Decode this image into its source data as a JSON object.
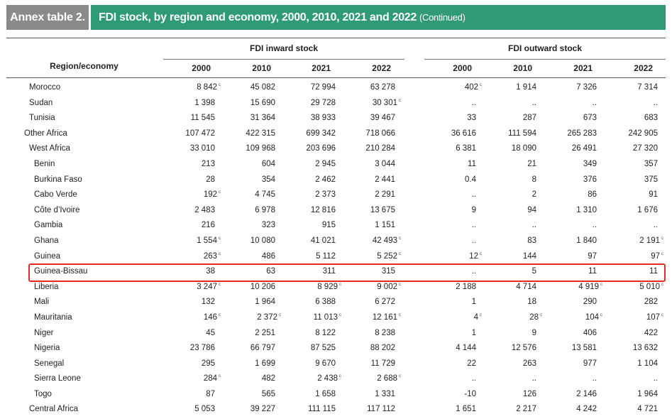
{
  "title": {
    "label": "Annex table 2.",
    "text": "FDI stock, by region and economy, 2000, 2010, 2021 and 2022",
    "continued": "(Continued)"
  },
  "header": {
    "region_label": "Region/economy",
    "inward_label": "FDI inward stock",
    "outward_label": "FDI outward stock",
    "years": [
      "2000",
      "2010",
      "2021",
      "2022"
    ]
  },
  "highlight_color": "#e52b20",
  "rows": [
    {
      "name": "Morocco",
      "indent": 1,
      "in": [
        "8 842",
        "45 082",
        "72 994",
        "63 278"
      ],
      "in_sup": [
        "c",
        "",
        "",
        ""
      ],
      "out": [
        "402",
        "1 914",
        "7 326",
        "7 314"
      ],
      "out_sup": [
        "c",
        "",
        "",
        ""
      ]
    },
    {
      "name": "Sudan",
      "indent": 1,
      "in": [
        "1 398",
        "15 690",
        "29 728",
        "30 301"
      ],
      "in_sup": [
        "",
        "",
        "",
        "c"
      ],
      "out": [
        "..",
        "..",
        "..",
        ".."
      ],
      "out_sup": [
        "",
        "",
        "",
        ""
      ]
    },
    {
      "name": "Tunisia",
      "indent": 1,
      "in": [
        "11 545",
        "31 364",
        "38 933",
        "39 467"
      ],
      "in_sup": [
        "",
        "",
        "",
        ""
      ],
      "out": [
        "33",
        "287",
        "673",
        "683"
      ],
      "out_sup": [
        "",
        "",
        "",
        ""
      ]
    },
    {
      "name": "Other Africa",
      "indent": 0,
      "in": [
        "107 472",
        "422 315",
        "699 342",
        "718 066"
      ],
      "in_sup": [
        "",
        "",
        "",
        ""
      ],
      "out": [
        "36 616",
        "111 594",
        "265 283",
        "242 905"
      ],
      "out_sup": [
        "",
        "",
        "",
        ""
      ]
    },
    {
      "name": "West Africa",
      "indent": 1,
      "in": [
        "33 010",
        "109 968",
        "203 696",
        "210 284"
      ],
      "in_sup": [
        "",
        "",
        "",
        ""
      ],
      "out": [
        "6 381",
        "18 090",
        "26 491",
        "27 320"
      ],
      "out_sup": [
        "",
        "",
        "",
        ""
      ]
    },
    {
      "name": "Benin",
      "indent": 2,
      "in": [
        "213",
        "604",
        "2 945",
        "3 044"
      ],
      "in_sup": [
        "",
        "",
        "",
        ""
      ],
      "out": [
        "11",
        "21",
        "349",
        "357"
      ],
      "out_sup": [
        "",
        "",
        "",
        ""
      ]
    },
    {
      "name": "Burkina Faso",
      "indent": 2,
      "in": [
        "28",
        "354",
        "2 462",
        "2 441"
      ],
      "in_sup": [
        "",
        "",
        "",
        ""
      ],
      "out": [
        "0.4",
        "8",
        "376",
        "375"
      ],
      "out_sup": [
        "",
        "",
        "",
        ""
      ]
    },
    {
      "name": "Cabo Verde",
      "indent": 2,
      "in": [
        "192",
        "4 745",
        "2 373",
        "2 291"
      ],
      "in_sup": [
        "c",
        "",
        "",
        ""
      ],
      "out": [
        "..",
        "2",
        "86",
        "91"
      ],
      "out_sup": [
        "",
        "",
        "",
        ""
      ]
    },
    {
      "name": "Côte d’Ivoire",
      "indent": 2,
      "in": [
        "2 483",
        "6 978",
        "12 816",
        "13 675"
      ],
      "in_sup": [
        "",
        "",
        "",
        ""
      ],
      "out": [
        "9",
        "94",
        "1 310",
        "1 676"
      ],
      "out_sup": [
        "",
        "",
        "",
        ""
      ]
    },
    {
      "name": "Gambia",
      "indent": 2,
      "in": [
        "216",
        "323",
        "915",
        "1 151"
      ],
      "in_sup": [
        "",
        "",
        "",
        ""
      ],
      "out": [
        "..",
        "..",
        "..",
        ".."
      ],
      "out_sup": [
        "",
        "",
        "",
        ""
      ]
    },
    {
      "name": "Ghana",
      "indent": 2,
      "in": [
        "1 554",
        "10 080",
        "41 021",
        "42 493"
      ],
      "in_sup": [
        "c",
        "",
        "",
        "c"
      ],
      "out": [
        "..",
        "83",
        "1 840",
        "2 191"
      ],
      "out_sup": [
        "",
        "",
        "",
        "c"
      ]
    },
    {
      "name": "Guinea",
      "indent": 2,
      "in": [
        "263",
        "486",
        "5 112",
        "5 252"
      ],
      "in_sup": [
        "c",
        "",
        "",
        "c"
      ],
      "out": [
        "12",
        "144",
        "97",
        "97"
      ],
      "out_sup": [
        "c",
        "",
        "",
        "c"
      ]
    },
    {
      "name": "Guinea-Bissau",
      "indent": 2,
      "in": [
        "38",
        "63",
        "311",
        "315"
      ],
      "in_sup": [
        "",
        "",
        "",
        ""
      ],
      "out": [
        "..",
        "5",
        "11",
        "11"
      ],
      "out_sup": [
        "",
        "",
        "",
        ""
      ]
    },
    {
      "name": "Liberia",
      "indent": 2,
      "in": [
        "3 247",
        "10 206",
        "8 929",
        "9 002"
      ],
      "in_sup": [
        "c",
        "",
        "c",
        "c"
      ],
      "out": [
        "2 188",
        "4 714",
        "4 919",
        "5 010"
      ],
      "out_sup": [
        "",
        "",
        "c",
        "c"
      ]
    },
    {
      "name": "Mali",
      "indent": 2,
      "in": [
        "132",
        "1 964",
        "6 388",
        "6 272"
      ],
      "in_sup": [
        "",
        "",
        "",
        ""
      ],
      "out": [
        "1",
        "18",
        "290",
        "282"
      ],
      "out_sup": [
        "",
        "",
        "",
        ""
      ]
    },
    {
      "name": "Mauritania",
      "indent": 2,
      "in": [
        "146",
        "2 372",
        "11 013",
        "12 161"
      ],
      "in_sup": [
        "c",
        "c",
        "c",
        "c"
      ],
      "out": [
        "4",
        "28",
        "104",
        "107"
      ],
      "out_sup": [
        "c",
        "c",
        "c",
        "c"
      ]
    },
    {
      "name": "Niger",
      "indent": 2,
      "in": [
        "45",
        "2 251",
        "8 122",
        "8 238"
      ],
      "in_sup": [
        "",
        "",
        "",
        ""
      ],
      "out": [
        "1",
        "9",
        "406",
        "422"
      ],
      "out_sup": [
        "",
        "",
        "",
        ""
      ]
    },
    {
      "name": "Nigeria",
      "indent": 2,
      "in": [
        "23 786",
        "66 797",
        "87 525",
        "88 202"
      ],
      "in_sup": [
        "",
        "",
        "",
        ""
      ],
      "out": [
        "4 144",
        "12 576",
        "13 581",
        "13 632"
      ],
      "out_sup": [
        "",
        "",
        "",
        ""
      ]
    },
    {
      "name": "Senegal",
      "indent": 2,
      "in": [
        "295",
        "1 699",
        "9 670",
        "11 729"
      ],
      "in_sup": [
        "",
        "",
        "",
        ""
      ],
      "out": [
        "22",
        "263",
        "977",
        "1 104"
      ],
      "out_sup": [
        "",
        "",
        "",
        ""
      ]
    },
    {
      "name": "Sierra Leone",
      "indent": 2,
      "in": [
        "284",
        "482",
        "2 438",
        "2 688"
      ],
      "in_sup": [
        "c",
        "",
        "c",
        "c"
      ],
      "out": [
        "..",
        "..",
        "..",
        ".."
      ],
      "out_sup": [
        "",
        "",
        "",
        ""
      ]
    },
    {
      "name": "Togo",
      "indent": 2,
      "in": [
        "87",
        "565",
        "1 658",
        "1 331"
      ],
      "in_sup": [
        "",
        "",
        "",
        ""
      ],
      "out": [
        "-10",
        "126",
        "2 146",
        "1 964"
      ],
      "out_sup": [
        "",
        "",
        "",
        ""
      ]
    },
    {
      "name": "Central Africa",
      "indent": 1,
      "in": [
        "5 053",
        "39 227",
        "111 115",
        "117 112"
      ],
      "in_sup": [
        "",
        "",
        "",
        ""
      ],
      "out": [
        "1 651",
        "2 217",
        "4 242",
        "4 721"
      ],
      "out_sup": [
        "",
        "",
        "",
        ""
      ]
    }
  ]
}
